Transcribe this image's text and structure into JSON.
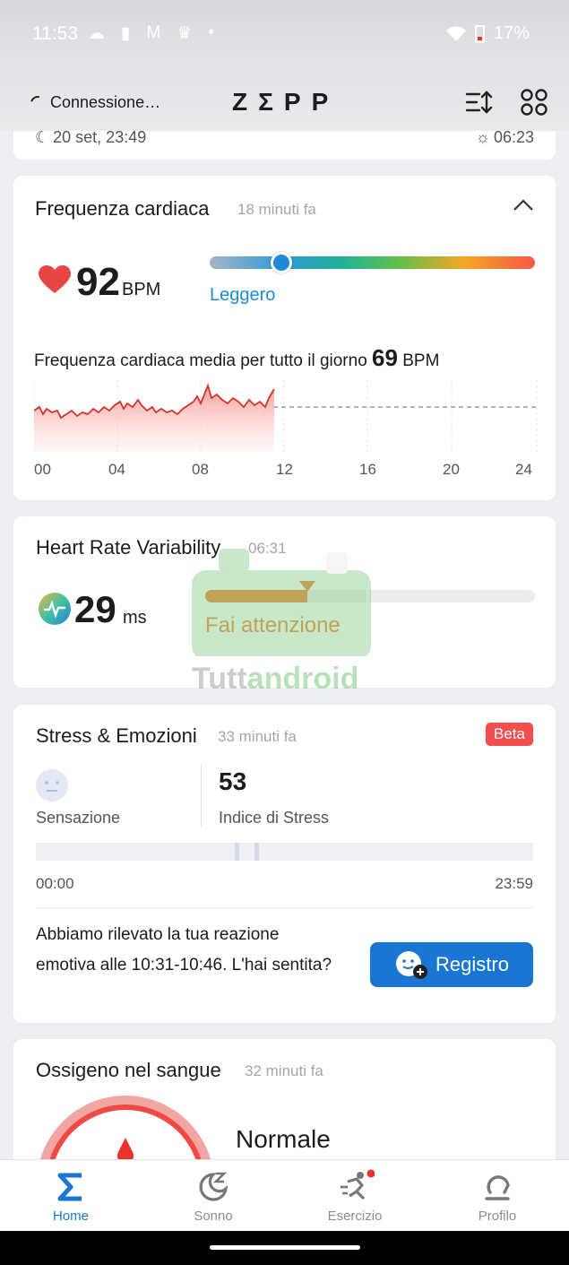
{
  "status_bar": {
    "time": "11:53",
    "battery": "17%",
    "dot": "•"
  },
  "header": {
    "connection": "Connessione…",
    "logo": "ZΣPP"
  },
  "prev_card": {
    "sleep_start": "20 set, 23:49",
    "sunrise": "06:23"
  },
  "heart_rate": {
    "title": "Frequenza cardiaca",
    "updated": "18 minuti fa",
    "value": "92",
    "unit": "BPM",
    "zone": "Leggero",
    "zone_level": 0.22,
    "avg_label": "Frequenza cardiaca media per tutto il giorno",
    "avg_value": "69",
    "avg_unit": "BPM",
    "x_ticks": [
      "00",
      "04",
      "08",
      "12",
      "16",
      "20",
      "24"
    ]
  },
  "hrv": {
    "title": "Heart Rate Variability",
    "time": "06:31",
    "value": "29",
    "unit": "ms",
    "status": "Fai attenzione",
    "level": 0.31
  },
  "watermark": {
    "part1": "Tutt",
    "part2": "android"
  },
  "stress": {
    "title": "Stress & Emozioni",
    "updated": "33 minuti fa",
    "badge": "Beta",
    "feeling_label": "Sensazione",
    "index_value": "53",
    "index_label": "Indice di Stress",
    "t_start": "00:00",
    "t_end": "23:59",
    "message": "Abbiamo rilevato la tua reazione emotiva alle 10:31-10:46. L'hai sentita?",
    "button": "Registro"
  },
  "spo2": {
    "title": "Ossigeno nel sangue",
    "updated": "32 minuti fa",
    "status": "Normale"
  },
  "nav": {
    "home": "Home",
    "sleep": "Sonno",
    "exercise": "Esercizio",
    "profile": "Profilo"
  },
  "colors": {
    "accent": "#1976d2",
    "heart": "#e84545",
    "orange": "#ef8a3c",
    "badge": "#f24e4e"
  }
}
